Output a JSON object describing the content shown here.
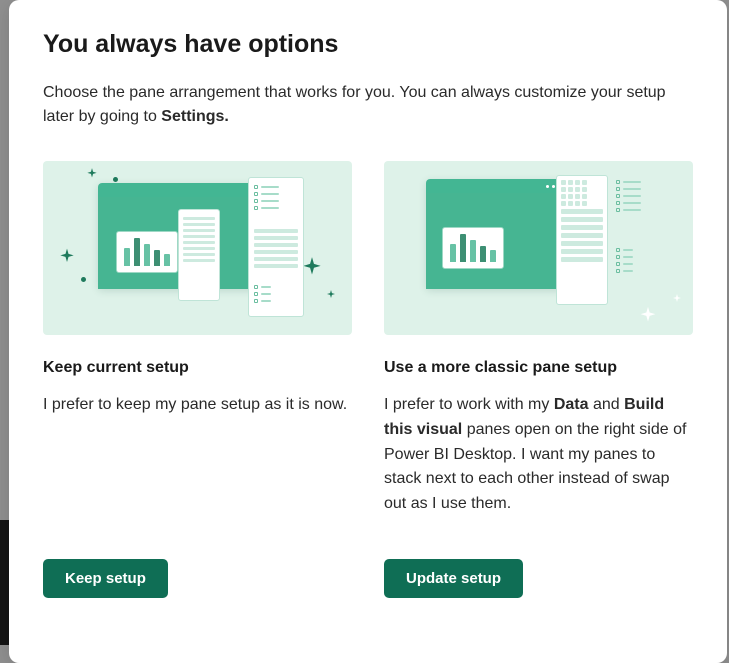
{
  "dialog": {
    "title": "You always have options",
    "subtitle_pre": "Choose the pane arrangement that works for you. You can always customize your setup later by going to ",
    "subtitle_bold": "Settings."
  },
  "options": {
    "keep": {
      "title": "Keep current setup",
      "desc": "I prefer to keep my pane setup as it is now.",
      "button": "Keep setup"
    },
    "classic": {
      "title": "Use a more classic pane setup",
      "desc_pre": "I prefer to work with my ",
      "desc_b1": "Data",
      "desc_mid": " and ",
      "desc_b2": "Build this visual",
      "desc_post": " panes open on the right side of Power BI Desktop. I want my panes to stack next to each other instead of swap out as I use them.",
      "button": "Update setup"
    }
  }
}
